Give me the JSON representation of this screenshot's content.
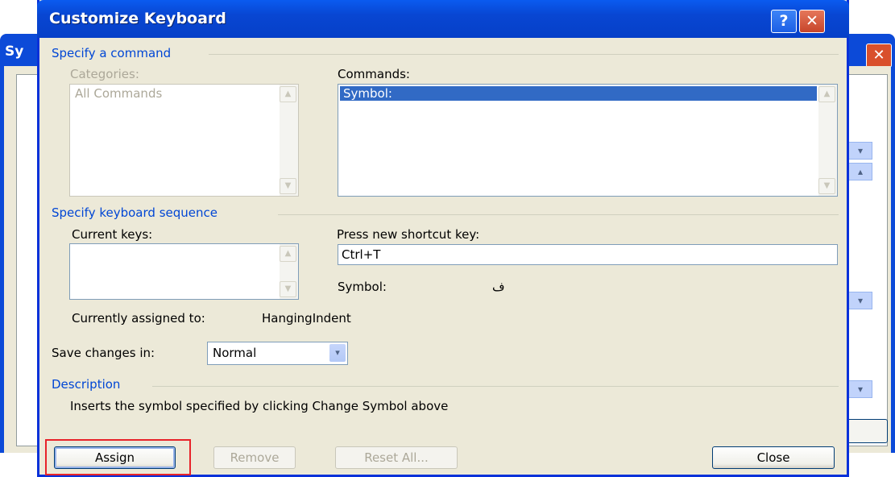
{
  "background_window": {
    "title_fragment": "Sy",
    "close_glyph": "✕"
  },
  "dialog": {
    "title": "Customize Keyboard",
    "help_glyph": "?",
    "close_glyph": "✕"
  },
  "specify_command": {
    "group_title": "Specify a command",
    "categories_label": "Categories:",
    "categories": [
      "All Commands"
    ],
    "commands_label": "Commands:",
    "commands": [
      "Symbol:"
    ],
    "selected_command": "Symbol:"
  },
  "keyboard_sequence": {
    "group_title": "Specify keyboard sequence",
    "current_keys_label": "Current keys:",
    "current_keys": [],
    "new_shortcut_label": "Press new shortcut key:",
    "new_shortcut_value": "Ctrl+T",
    "symbol_label": "Symbol:",
    "symbol_value": "ف",
    "currently_assigned_label": "Currently assigned to:",
    "currently_assigned_value": "HangingIndent"
  },
  "save_changes": {
    "label": "Save changes in:",
    "selected": "Normal"
  },
  "description": {
    "group_title": "Description",
    "text": "Inserts the symbol specified by clicking Change Symbol above"
  },
  "buttons": {
    "assign": "Assign",
    "remove": "Remove",
    "reset_all": "Reset All...",
    "close": "Close"
  },
  "icons": {
    "scroll_up": "▲",
    "scroll_down": "▼",
    "dropdown": "▾"
  }
}
